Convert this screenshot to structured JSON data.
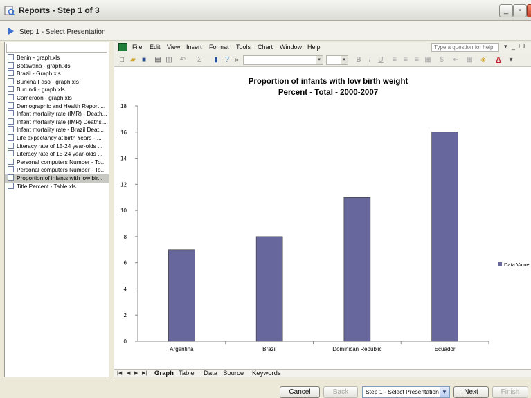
{
  "window": {
    "title": "Reports - Step 1 of 3"
  },
  "step": {
    "label": "Step 1 - Select Presentation"
  },
  "search": {
    "value": ""
  },
  "files": [
    "Benin - graph.xls",
    "Botswana - graph.xls",
    "Brazil - Graph.xls",
    "Burkina Faso - graph.xls",
    "Burundi - graph.xls",
    "Cameroon - graph.xls",
    "Demographic and Health Report ...",
    "Infant mortality rate (IMR) - Death...",
    "Infant mortality rate (IMR) Deaths...",
    "Infant mortality rate - Brazil Deat...",
    "Life expectancy at birth Years - ...",
    "Literacy rate of 15-24 year-olds ...",
    "Literacy rate of 15-24 year-olds ...",
    "Personal computers Number - To...",
    "Personal computers Number - To...",
    "Proportion of infants with low bir...",
    "Title Percent - Table.xls"
  ],
  "menu": [
    "File",
    "Edit",
    "View",
    "Insert",
    "Format",
    "Tools",
    "Chart",
    "Window",
    "Help"
  ],
  "help_placeholder": "Type a question for help",
  "sheet_tabs": [
    "Graph",
    "Table",
    "Data",
    "Source",
    "Keywords"
  ],
  "buttons": {
    "cancel": "Cancel",
    "back": "Back",
    "next": "Next",
    "finish": "Finish"
  },
  "step_select": "Step 1 - Select Presentation",
  "colors": {
    "bar": "#67679e",
    "accent": "#3a6fd0"
  },
  "chart_data": {
    "type": "bar",
    "title": "Proportion of infants with low birth weight",
    "subtitle": "Percent - Total - 2000-2007",
    "categories": [
      "Argentina",
      "Brazil",
      "Dominican Republic",
      "Ecuador"
    ],
    "series": [
      {
        "name": "Data Value",
        "values": [
          7,
          8,
          11,
          16
        ]
      }
    ],
    "ylim": [
      0,
      18
    ],
    "yticks": [
      0,
      2,
      4,
      6,
      8,
      10,
      12,
      14,
      16,
      18
    ],
    "grid": false,
    "legend": "right"
  }
}
